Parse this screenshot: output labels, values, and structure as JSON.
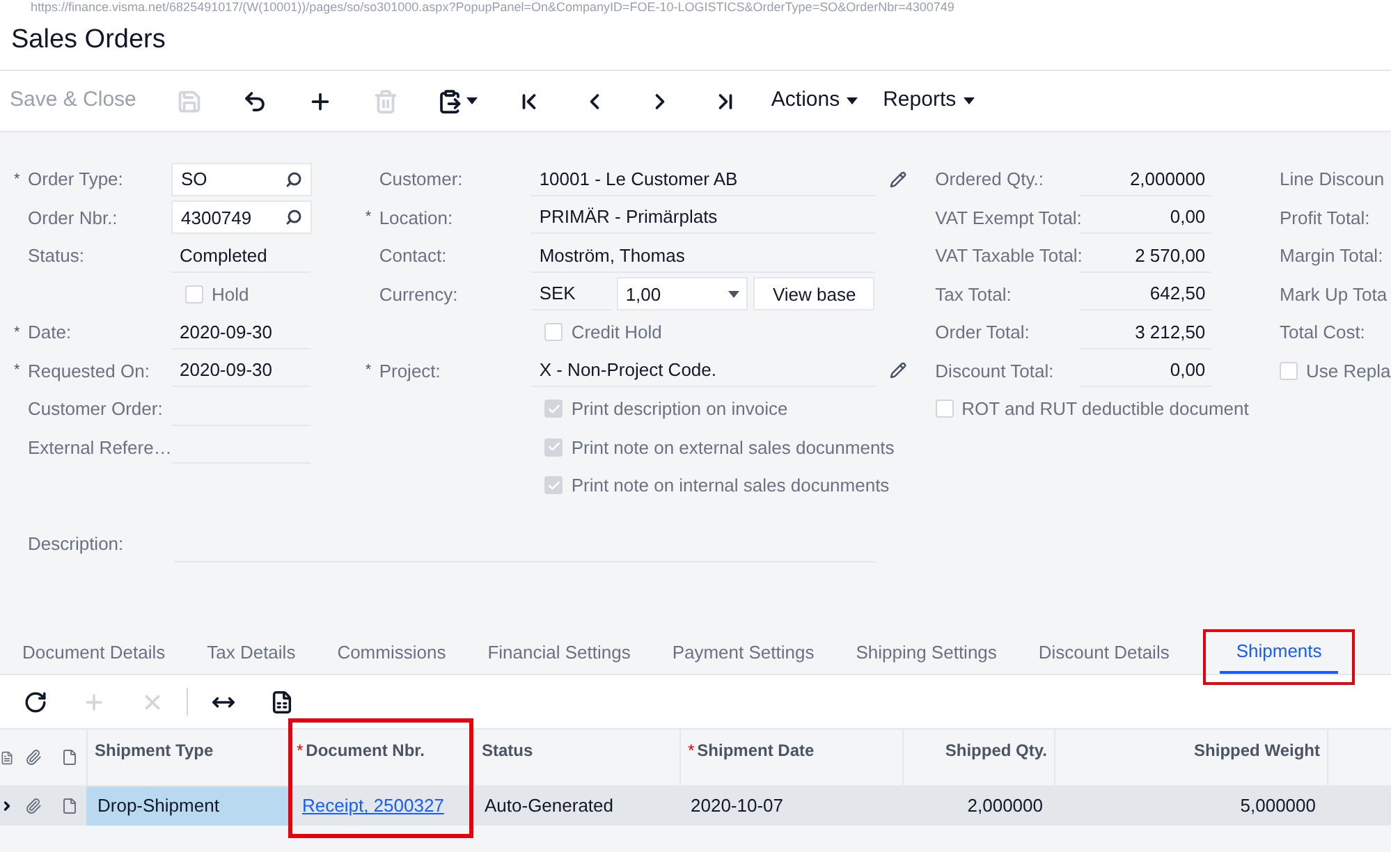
{
  "address_bar": {
    "url": "https://finance.visma.net/6825491017/(W(10001))/pages/so/so301000.aspx?PopupPanel=On&CompanyID=FOE-10-LOGISTICS&OrderType=SO&OrderNbr=4300749"
  },
  "window": {
    "title": "Sales Orders"
  },
  "toolbar": {
    "items": [
      {
        "kind": "text",
        "label": "Save & Close",
        "disabled": true
      },
      {
        "kind": "icon",
        "disabled": true
      },
      {
        "kind": "icon",
        "disabled": false
      },
      {
        "kind": "icon",
        "disabled": false
      },
      {
        "kind": "icon",
        "disabled": true
      },
      {
        "kind": "icon-menu",
        "disabled": false
      },
      {
        "kind": "icon",
        "disabled": false
      },
      {
        "kind": "icon",
        "disabled": false
      },
      {
        "kind": "icon",
        "disabled": false
      },
      {
        "kind": "icon",
        "disabled": false
      },
      {
        "kind": "menu",
        "label": "Actions",
        "disabled": false
      },
      {
        "kind": "menu",
        "label": "Reports",
        "disabled": false
      }
    ]
  },
  "form": {
    "columns": [
      [
        {
          "kind": "lookup",
          "label": "Order Type:",
          "required_mark": "*",
          "value": "SO"
        },
        {
          "kind": "lookup",
          "label": "Order Nbr.:",
          "value": "4300749"
        },
        {
          "kind": "text",
          "label": "Status:",
          "value": "Completed"
        },
        {
          "kind": "checkbox",
          "label": "Hold",
          "checked": false,
          "disabled": false
        },
        {
          "kind": "text",
          "label": "Date:",
          "required_mark": "*",
          "value": "2020-09-30"
        },
        {
          "kind": "text",
          "label": "Requested On:",
          "required_mark": "*",
          "value": "2020-09-30"
        },
        {
          "kind": "text",
          "label": "Customer Order:"
        },
        {
          "kind": "text",
          "label": "External Refere…"
        }
      ],
      [
        {
          "kind": "edit",
          "label": "Customer:",
          "value": "10001 - Le Customer AB"
        },
        {
          "kind": "text",
          "label": "Location:",
          "required_mark": "*",
          "value": "PRIMÄR - Primärplats"
        },
        {
          "kind": "text",
          "label": "Contact:",
          "value": "Moström, Thomas"
        },
        {
          "kind": "currency",
          "label": "Currency:",
          "value": "SEK",
          "rate": "1,00",
          "button": "View base"
        },
        {
          "kind": "checkbox",
          "label": "Credit Hold",
          "checked": false,
          "disabled": false
        },
        {
          "kind": "edit",
          "label": "Project:",
          "required_mark": "*",
          "value": "X - Non-Project Code."
        },
        {
          "kind": "checkbox",
          "label": "Print description on invoice",
          "checked": true,
          "disabled": true
        },
        {
          "kind": "checkbox",
          "label": "Print note on external sales docunments",
          "checked": true,
          "disabled": true
        },
        {
          "kind": "checkbox",
          "label": "Print note on internal sales docunments",
          "checked": true,
          "disabled": true
        }
      ],
      [
        {
          "kind": "number",
          "label": "Ordered Qty.:",
          "value": "2,000000"
        },
        {
          "kind": "number",
          "label": "VAT Exempt Total:",
          "value": "0,00"
        },
        {
          "kind": "number",
          "label": "VAT Taxable Total:",
          "value": "2 570,00"
        },
        {
          "kind": "number",
          "label": "Tax Total:",
          "value": "642,50"
        },
        {
          "kind": "number",
          "label": "Order Total:",
          "value": "3 212,50"
        },
        {
          "kind": "number",
          "label": "Discount Total:",
          "value": "0,00"
        },
        {
          "kind": "checkbox",
          "label": "ROT and RUT deductible document",
          "checked": false,
          "disabled": false
        }
      ],
      [
        {
          "kind": "number",
          "label": "Line Discoun"
        },
        {
          "kind": "number",
          "label": "Profit Total:"
        },
        {
          "kind": "number",
          "label": "Margin Total:"
        },
        {
          "kind": "number",
          "label": "Mark Up Tota"
        },
        {
          "kind": "number",
          "label": "Total Cost:"
        },
        {
          "kind": "checkbox",
          "label": "Use Repla",
          "checked": false,
          "disabled": false
        }
      ]
    ],
    "description": {
      "label": "Description:"
    }
  },
  "tabs": [
    {
      "label": "Document Details",
      "selected": false,
      "highlighted": false
    },
    {
      "label": "Tax Details",
      "selected": false,
      "highlighted": false
    },
    {
      "label": "Commissions",
      "selected": false,
      "highlighted": false
    },
    {
      "label": "Financial Settings",
      "selected": false,
      "highlighted": false
    },
    {
      "label": "Payment Settings",
      "selected": false,
      "highlighted": false
    },
    {
      "label": "Shipping Settings",
      "selected": false,
      "highlighted": false
    },
    {
      "label": "Discount Details",
      "selected": false,
      "highlighted": false
    },
    {
      "label": "Shipments",
      "selected": true,
      "highlighted": true
    }
  ],
  "grid_toolbar": {
    "items": [
      {
        "disabled": false
      },
      {
        "disabled": true
      },
      {
        "disabled": true
      },
      {
        "disabled": false
      },
      {
        "disabled": false
      }
    ]
  },
  "table": {
    "columns": [
      {
        "label": "Shipment Type",
        "highlighted": false
      },
      {
        "label": "Document Nbr.",
        "required_mark": "*",
        "highlighted": true
      },
      {
        "label": "Status",
        "highlighted": false
      },
      {
        "label": "Shipment Date",
        "required_mark": "*",
        "highlighted": false
      },
      {
        "label": "Shipped Qty.",
        "highlighted": false
      },
      {
        "label": "Shipped Weight",
        "highlighted": false
      }
    ],
    "rows": [
      {
        "selected": true,
        "cells": [
          "Drop-Shipment",
          "Receipt, 2500327",
          "Auto-Generated",
          "2020-10-07",
          "2,000000",
          "5,000000"
        ]
      }
    ]
  }
}
